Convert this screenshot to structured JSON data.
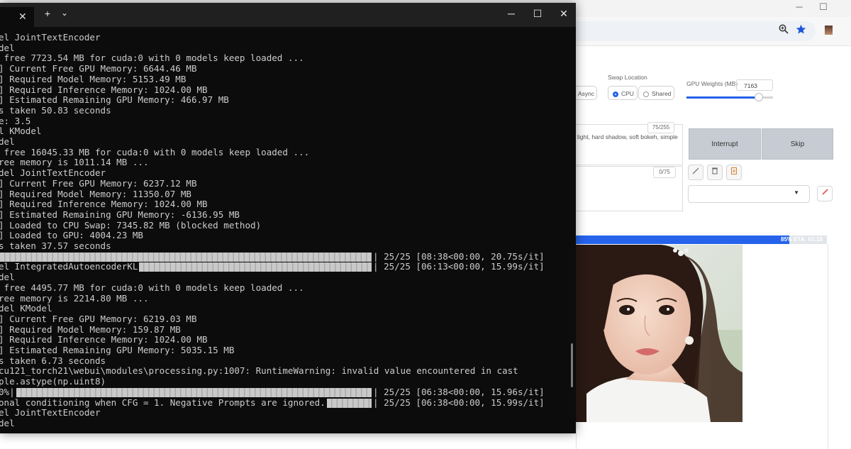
{
  "terminal": {
    "tab_close": "✕",
    "new_tab": "+",
    "tab_menu": "⌄",
    "minimize": "─",
    "maximize": "☐",
    "close": "✕",
    "lines": [
      "el JointTextEncoder",
      "del",
      " free 7723.54 MB for cuda:0 with 0 models keep loaded ...",
      "] Current Free GPU Memory: 6644.46 MB",
      "] Required Model Memory: 5153.49 MB",
      "] Required Inference Memory: 1024.00 MB",
      "] Estimated Remaining GPU Memory: 466.97 MB",
      "s taken 50.83 seconds",
      "e: 3.5",
      "l KModel",
      "del",
      " free 16045.33 MB for cuda:0 with 0 models keep loaded ...",
      "ree memory is 1011.14 MB ...",
      "del JointTextEncoder",
      "] Current Free GPU Memory: 6237.12 MB",
      "] Required Model Memory: 11350.07 MB",
      "] Required Inference Memory: 1024.00 MB",
      "] Estimated Remaining GPU Memory: -6136.95 MB",
      "] Loaded to CPU Swap: 7345.82 MB (blocked method)",
      "] Loaded to GPU: 4004.23 MB",
      "s taken 37.57 seconds",
      "",
      "el IntegratedAutoencoderKL",
      "del",
      " free 4495.77 MB for cuda:0 with 0 models keep loaded ...",
      "ree memory is 2214.80 MB ...",
      "del KModel",
      "] Current Free GPU Memory: 6219.03 MB",
      "] Required Model Memory: 159.87 MB",
      "] Required Inference Memory: 1024.00 MB",
      "] Estimated Remaining GPU Memory: 5035.15 MB",
      "s taken 6.73 seconds",
      "cu121_torch21\\webui\\modules\\processing.py:1007: RuntimeWarning: invalid value encountered in cast",
      "ple.astype(np.uint8)",
      "0%|",
      "onal conditioning when CFG = 1. Negative Prompts are ignored.",
      "el JointTextEncoder",
      "del"
    ],
    "progress_lines": [
      {
        "line": 21,
        "text": "| 25/25 [08:38<00:00, 20.75s/it]"
      },
      {
        "line": 22,
        "text": "| 25/25 [06:13<00:00, 15.99s/it]"
      },
      {
        "line": 34,
        "text": "| 25/25 [06:38<00:00, 15.96s/it]"
      },
      {
        "line": 35,
        "text": "| 25/25 [06:38<00:00, 15.99s/it]"
      }
    ]
  },
  "webui": {
    "swap_location_label": "Swap Location",
    "async_label": "Async",
    "swap_options": [
      "CPU",
      "Shared"
    ],
    "swap_selected": "CPU",
    "gpu_weights_label": "GPU Weights (MB)",
    "gpu_weights_value": "7163",
    "gpu_weights_slider_fraction": 0.84,
    "prompt_counter": "75/255",
    "prompt_text": "light, hard shadow, soft bokeh, simple",
    "negative_counter": "0/75",
    "interrupt_label": "Interrupt",
    "skip_label": "Skip",
    "progress_text": "85% ETA: 01:15",
    "progress_fraction": 0.85
  },
  "browser": {
    "minimize": "─",
    "maximize": "☐",
    "menu_dots": "⋮"
  }
}
